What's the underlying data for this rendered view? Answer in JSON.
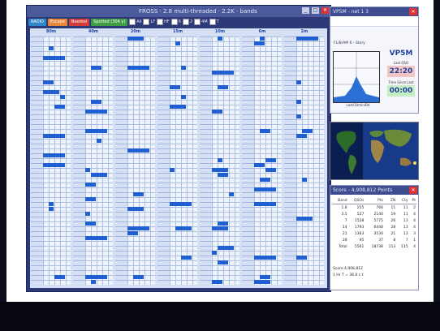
{
  "main_window": {
    "title": "FROSS · 2.8 multi-threaded · 2.2K · bands",
    "controls": [
      "_",
      "□",
      "✕"
    ]
  },
  "toolbar": {
    "pills": [
      {
        "label": "RADIO",
        "color": "#2f86c9"
      },
      {
        "label": "Escape",
        "color": "#e8863a"
      },
      {
        "label": "Needed",
        "color": "#d43b3b"
      },
      {
        "label": "Spotted (304 y)",
        "color": "#3f9e44"
      }
    ],
    "checkboxes": [
      "All",
      "LF",
      "HF",
      "6",
      "2",
      "4M",
      "T",
      "?",
      "S"
    ]
  },
  "bands": [
    {
      "label": "80m"
    },
    {
      "label": "40m"
    },
    {
      "label": "20m"
    },
    {
      "label": "15m"
    },
    {
      "label": "10m"
    },
    {
      "label": "6m"
    },
    {
      "label": "2m"
    }
  ],
  "schedule": {
    "title": "VP5M - net 1 3 ",
    "banner": "",
    "graph_label": "Last/10min/Bd",
    "graph_caption": "FL/B/AM 6 - Story",
    "callsign": "VP5M",
    "last_qso_label": "Last QSO",
    "last_qso": "22:20",
    "since_label": "Time Since Last",
    "since": "00:00"
  },
  "map": {
    "title": ""
  },
  "score": {
    "title": "Score - 4,908,812 Points",
    "headers": [
      "Band",
      "QSOs",
      "Pts",
      "ZN",
      "Cty",
      "Pt"
    ],
    "rows": [
      [
        "1.8",
        "255",
        "766",
        "11",
        "11",
        "2"
      ],
      [
        "3.5",
        "527",
        "2140",
        "19",
        "11",
        "4"
      ],
      [
        "7",
        "1528",
        "5775",
        "26",
        "13",
        "4"
      ],
      [
        "14",
        "1793",
        "6440",
        "28",
        "13",
        "4"
      ],
      [
        "21",
        "1363",
        "3530",
        "21",
        "13",
        "3"
      ],
      [
        "28",
        "95",
        "37",
        "8",
        "7",
        "1"
      ],
      [
        "Total",
        "5561",
        "18738",
        "113",
        "115",
        "4"
      ]
    ],
    "score_label": "Score  4,908,812",
    "rate_label": "1 Hr T = 36.6 c t"
  }
}
